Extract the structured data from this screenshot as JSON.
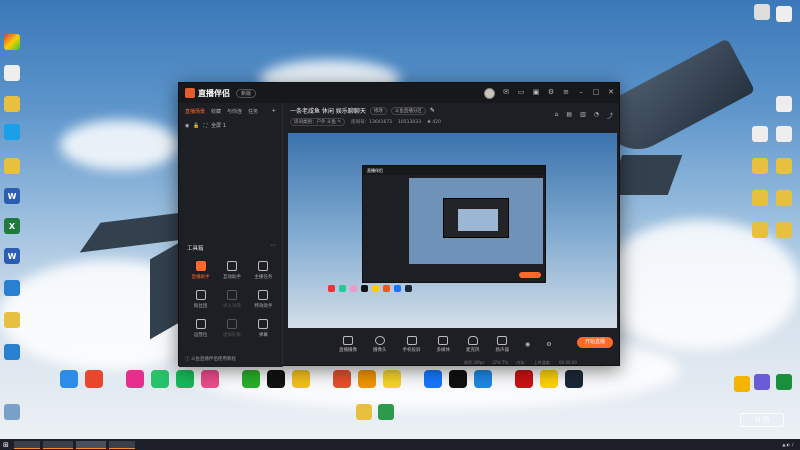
{
  "app": {
    "brand": "直播伴侣",
    "version_pill": "新版",
    "left_tabs": [
      "直播场景",
      "收藏",
      "与你连",
      "任务"
    ],
    "scene_item": "全屏 1",
    "tools_title": "工具箱",
    "tools": [
      {
        "label": "直播助手",
        "icon": "live-assist-icon",
        "state": "active"
      },
      {
        "label": "互动助手",
        "icon": "interact-icon",
        "state": "normal"
      },
      {
        "label": "主播任务",
        "icon": "task-icon",
        "state": "normal"
      },
      {
        "label": "粉丝团",
        "icon": "fans-icon",
        "state": "normal"
      },
      {
        "label": "导入场景",
        "icon": "import-icon",
        "state": "disabled"
      },
      {
        "label": "特效助手",
        "icon": "effect-icon",
        "state": "normal"
      },
      {
        "label": "运营位",
        "icon": "ops-icon",
        "state": "normal"
      },
      {
        "label": "虚拟形象",
        "icon": "avatar-icon",
        "state": "disabled"
      },
      {
        "label": "弹幕",
        "icon": "danmaku-icon",
        "state": "normal"
      }
    ],
    "left_footer": "斗鱼直播伴侣使用教程",
    "stream_title": "一条老咸鱼 休闲 娱乐聊聊天",
    "stream_tag": "修改",
    "stream_tag2": "斗鱼直播分区",
    "room_info": [
      "房间类别：户外 斗鱼 ✎",
      "房间号：13641673",
      "10513033",
      "♣ 420"
    ],
    "bottom_tools": [
      "直播摄像",
      "摄像头",
      "手机投屏",
      "多媒体",
      "麦克风",
      "扬声器"
    ],
    "start_button": "开始直播",
    "status": [
      "帧率:30fps",
      "CPU:7%",
      "内存:",
      "上传速度:",
      "00:00:00"
    ]
  },
  "desktop": {
    "dock_labels": [
      "",
      "",
      "",
      "",
      "",
      "",
      "",
      "",
      "",
      "",
      "",
      "",
      "",
      "",
      ""
    ]
  },
  "taskbar": {
    "items": [
      "",
      "",
      "",
      ""
    ]
  },
  "colors": {
    "accent": "#ff6a2a",
    "window_bg": "#1e1f24"
  }
}
